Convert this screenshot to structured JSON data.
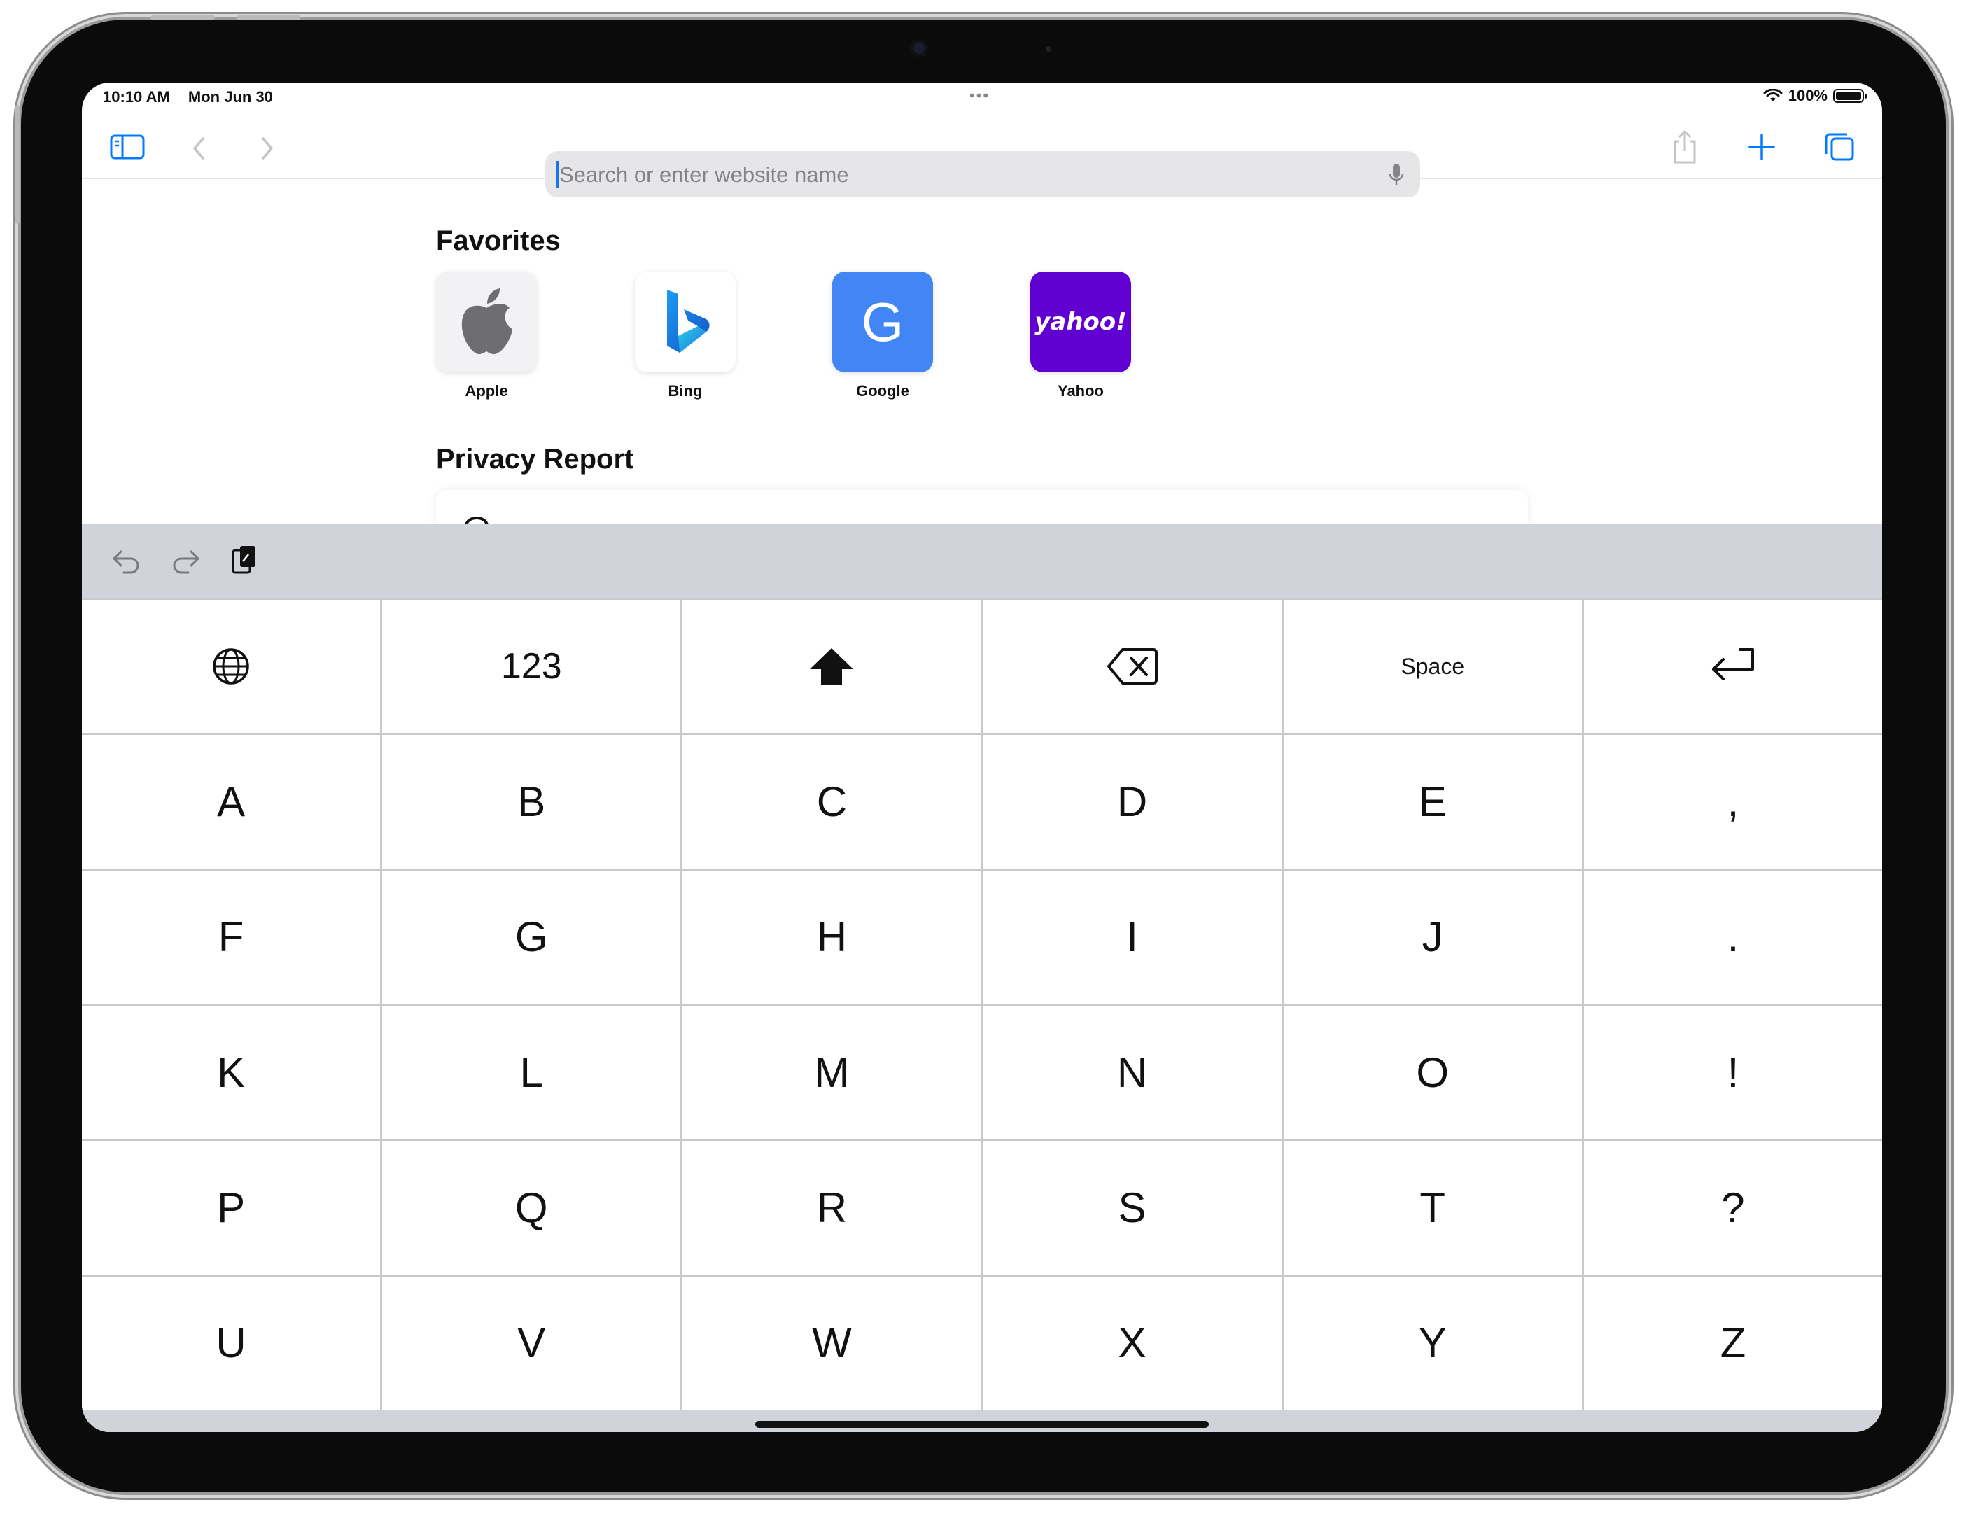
{
  "status_bar": {
    "time": "10:10 AM",
    "date": "Mon Jun 30",
    "battery": "100%",
    "battery_level": 1.0
  },
  "toolbar": {
    "search_placeholder": "Search or enter website name",
    "icons": [
      "sidebar-icon",
      "back-icon",
      "forward-icon",
      "microphone-icon",
      "share-icon",
      "new-tab-icon",
      "tabs-overview-icon"
    ]
  },
  "favorites": {
    "title": "Favorites",
    "items": [
      {
        "label": "Apple",
        "icon": "apple-logo-icon"
      },
      {
        "label": "Bing",
        "icon": "bing-logo-icon"
      },
      {
        "label": "Google",
        "icon": "google-logo-icon",
        "glyph": "G",
        "color": "#4285f4"
      },
      {
        "label": "Yahoo",
        "icon": "yahoo-logo-icon",
        "glyph": "yahoo!",
        "color": "#6001d2"
      }
    ]
  },
  "privacy": {
    "title": "Privacy Report"
  },
  "keyboard_toolbar": {
    "icons": [
      "undo-icon",
      "redo-icon",
      "paste-icon"
    ]
  },
  "keyboard": {
    "function_row": {
      "numbers": "123",
      "space": "Space"
    },
    "rows": [
      [
        "A",
        "B",
        "C",
        "D",
        "E",
        ","
      ],
      [
        "F",
        "G",
        "H",
        "I",
        "J",
        "."
      ],
      [
        "K",
        "L",
        "M",
        "N",
        "O",
        "!"
      ],
      [
        "P",
        "Q",
        "R",
        "S",
        "T",
        "?"
      ],
      [
        "U",
        "V",
        "W",
        "X",
        "Y",
        "Z"
      ]
    ]
  },
  "colors": {
    "accent": "#007aff",
    "keyboard_bar": "#d0d3d9"
  }
}
